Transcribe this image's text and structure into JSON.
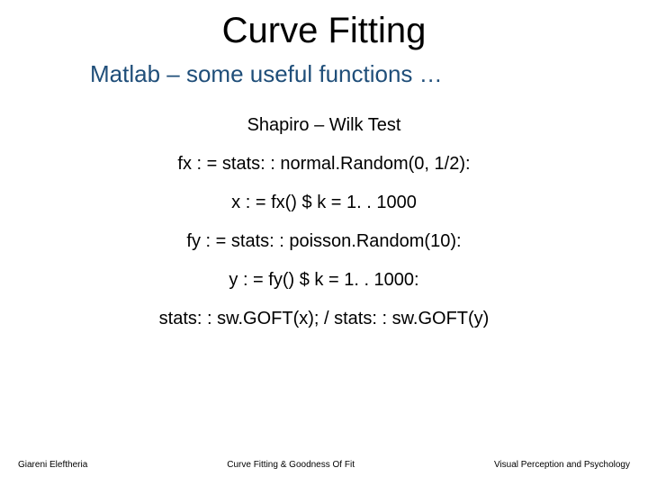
{
  "title": "Curve Fitting",
  "subtitle": "Matlab – some useful functions …",
  "lines": {
    "l0": "Shapiro – Wilk Test",
    "l1": "fx : = stats: : normal.Random(0, 1/2):",
    "l2": "x : = fx() $ k = 1. . 1000",
    "l3": "fy : = stats: : poisson.Random(10):",
    "l4": "y : = fy() $ k = 1. . 1000:",
    "l5": "stats: : sw.GOFT(x); /  stats: : sw.GOFT(y)"
  },
  "footer": {
    "left": "Giareni Eleftheria",
    "center": "Curve Fitting & Goodness Of Fit",
    "right": "Visual Perception and Psychology"
  }
}
